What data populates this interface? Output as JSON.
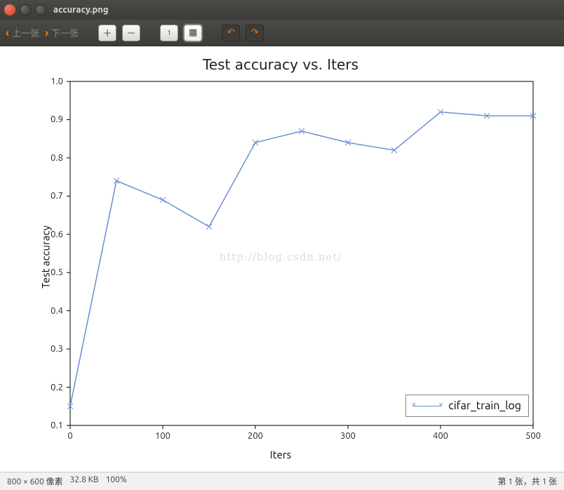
{
  "window": {
    "title": "accuracy.png"
  },
  "toolbar": {
    "prev_label": "上一张",
    "next_label": "下一张",
    "zoom_in_icon": "⊕",
    "zoom_out_icon": "⊖",
    "onehundred_icon": "⌖1",
    "fit_icon": "⛶",
    "rotate_ccw_icon": "↶",
    "rotate_cw_icon": "↷"
  },
  "status": {
    "dimensions": "800 × 600 像素",
    "filesize": "32.8 KB",
    "zoom": "100%",
    "page": "第 1 张，共 1 张"
  },
  "watermark": "http://blog.csdn.net/",
  "chart_data": {
    "type": "line",
    "title": "Test accuracy  vs. Iters",
    "xlabel": "Iters",
    "ylabel": "Test accuracy",
    "xlim": [
      0,
      500
    ],
    "ylim": [
      0.1,
      1.0
    ],
    "xticks": [
      0,
      100,
      200,
      300,
      400,
      500
    ],
    "yticks": [
      0.1,
      0.2,
      0.3,
      0.4,
      0.5,
      0.6,
      0.7,
      0.8,
      0.9,
      1.0
    ],
    "series": [
      {
        "name": "cifar_train_log",
        "marker": "x",
        "color": "#6a8fd6",
        "x": [
          0,
          50,
          100,
          150,
          200,
          250,
          300,
          350,
          400,
          450,
          500
        ],
        "y": [
          0.15,
          0.74,
          0.69,
          0.62,
          0.84,
          0.87,
          0.84,
          0.82,
          0.92,
          0.91,
          0.91
        ]
      }
    ],
    "legend_position": "lower right"
  }
}
